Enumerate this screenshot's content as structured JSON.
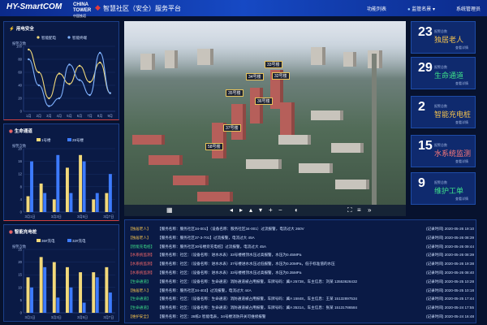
{
  "header": {
    "logo": "HY-SmartCOM",
    "brand_en": "CHINA TOWER",
    "brand_cn": "中国铁塔",
    "title": "智慧社区（安全）服务平台",
    "nav": [
      {
        "label": "功能列表",
        "icon": "list-icon"
      },
      {
        "label": "监管名景",
        "icon": "pin-icon"
      },
      {
        "label": "系统管理员",
        "icon": "user-icon"
      }
    ]
  },
  "panels": {
    "electric": {
      "title": "用电安全",
      "icon": "lightning-icon"
    },
    "lifeline": {
      "title": "生命通道",
      "icon": "shield-icon"
    },
    "charging": {
      "title": "智能充电桩",
      "icon": "plug-icon"
    }
  },
  "chart_data": [
    {
      "type": "line",
      "title": "用电安全",
      "ylabel": "报警次数",
      "ylim": [
        0,
        100
      ],
      "yticks": [
        0,
        20,
        40,
        60,
        80,
        100
      ],
      "categories": [
        "1月",
        "2月",
        "3月",
        "4月",
        "5月",
        "6月",
        "7月",
        "8月",
        "9月"
      ],
      "series": [
        {
          "name": "智能配电",
          "color": "#f2d97a",
          "values": [
            95,
            60,
            20,
            58,
            42,
            70,
            45,
            75,
            28
          ]
        },
        {
          "name": "智能终端",
          "color": "#7fb2ff",
          "values": [
            80,
            40,
            8,
            20,
            72,
            48,
            25,
            90,
            28
          ]
        }
      ]
    },
    {
      "type": "bar",
      "title": "生命通道",
      "ylabel": "报警次数",
      "ylim": [
        0,
        20
      ],
      "categories": [
        "3月1日",
        "",
        "3月3日",
        "",
        "3月5日",
        "",
        "3月7日"
      ],
      "series": [
        {
          "name": "1号楼",
          "color": "#f2d97a",
          "values": [
            5,
            9,
            4,
            14,
            18,
            4,
            6
          ]
        },
        {
          "name": "28号楼",
          "color": "#3d7bff",
          "values": [
            16,
            6,
            18,
            6,
            16,
            6,
            12
          ]
        }
      ]
    },
    {
      "type": "bar",
      "title": "智能充电桩",
      "ylabel": "报警次数",
      "ylim": [
        0,
        25
      ],
      "categories": [
        "3月1日",
        "",
        "3月3日",
        "",
        "3月5日",
        "",
        "3月7日"
      ],
      "series": [
        {
          "name": "36#充电",
          "color": "#f2d97a",
          "values": [
            14,
            22,
            20,
            18,
            16,
            16,
            18
          ]
        },
        {
          "name": "32#充电",
          "color": "#3d7bff",
          "values": [
            10,
            18,
            6,
            10,
            4,
            14,
            8
          ]
        }
      ]
    }
  ],
  "stats": [
    {
      "num": "23",
      "caption": "报警总数",
      "name": "独居老人",
      "detail": "查看详情",
      "color": "#f2c14e"
    },
    {
      "num": "29",
      "caption": "报警总数",
      "name": "生命通道",
      "detail": "查看详情",
      "color": "#3ee08a"
    },
    {
      "num": "2",
      "caption": "报警总数",
      "name": "智能充电桩",
      "detail": "查看详情",
      "color": "#f2c14e"
    },
    {
      "num": "15",
      "caption": "报警总数",
      "name": "水系统监测",
      "detail": "查看详情",
      "color": "#ff7a7a"
    },
    {
      "num": "9",
      "caption": "报警总数",
      "name": "维护工单",
      "detail": "查看详情",
      "color": "#3ee08a"
    }
  ],
  "map": {
    "tags": [
      "33号楼",
      "34号楼",
      "32号楼",
      "35号楼",
      "36号楼",
      "37号楼",
      "58号楼"
    ]
  },
  "events": [
    {
      "type": "【独居老人】",
      "color": "#f2c14e",
      "text": "【服务名称：服务社区34-001】（设备名称：服务社区34-001）过流报警，电流过大 260V",
      "time": "(记录时间) 2020-05-26 19:10"
    },
    {
      "type": "【独居老人】",
      "color": "#f2c14e",
      "text": "【服务名称：服务社区37-3-701】过流报警，电流过大 45A",
      "time": "(记录时间) 2020-05-26 08:39"
    },
    {
      "type": "【智能充电桩】",
      "color": "#3ee08a",
      "text": "【服务名称：服务社区30号楼旁充电桩】过流报警，电流过大 45A",
      "time": "(记录时间) 2020-05-26 09:44"
    },
    {
      "type": "【水系统监测】",
      "color": "#ff6b6b",
      "text": "【服务名称：社区：（设备名称：进水水表）33号楼楼顶水压过高报警，水压为0.45MPa",
      "time": "(记录时间) 2020-05-26 08:39"
    },
    {
      "type": "【水系统监测】",
      "color": "#ff6b6b",
      "text": "【服务名称：社区：（设备名称：进水水表）37号楼进水水压过低报警，水压为0.20MPa，低于标准值的水压",
      "time": "(记录时间) 2020-05-26 19:38"
    },
    {
      "type": "【水系统监测】",
      "color": "#ff6b6b",
      "text": "【服务名称：社区：（设备名称：进水水表）33号楼楼顶水压过高报警，水压为0.35MPa",
      "time": "(记录时间) 2020-05-26 08:40"
    },
    {
      "type": "【生命通道】",
      "color": "#3ee08a",
      "text": "【服务名称：社区：（设备名称：生命通道）消防通道被占用报警，车牌号码：冀A 25738，车主信息：刘某 13553626432",
      "time": "(记录时间) 2020-05-25 10:28"
    },
    {
      "type": "【独居老人】",
      "color": "#f2c14e",
      "text": "【服务名称：服务社区34-403】过流报警，电流过大 44A",
      "time": "(记录时间) 2020-05-25 10:18"
    },
    {
      "type": "【生命通道】",
      "color": "#3ee08a",
      "text": "【服务名称：社区：（设备名称：生命通道）消防通道被占用报警，车牌号码：冀A 15848，车主信息：王某 15132897534",
      "time": "(记录时间) 2020-05-25 17:44"
    },
    {
      "type": "【生命通道】",
      "color": "#3ee08a",
      "text": "【服务名称：社区：（设备名称：生命通道）消防通道被占用报警，车牌号码：冀A 35314，车主信息：张某 15131786584",
      "time": "(记录时间) 2020-05-24 17:55"
    },
    {
      "type": "【维护安全】",
      "color": "#f2c14e",
      "text": "【服务名称：社区：28栋2 智能电表，34号楼消防开关可维修报警",
      "time": "(记录时间) 2020-05-24 16:48"
    }
  ]
}
